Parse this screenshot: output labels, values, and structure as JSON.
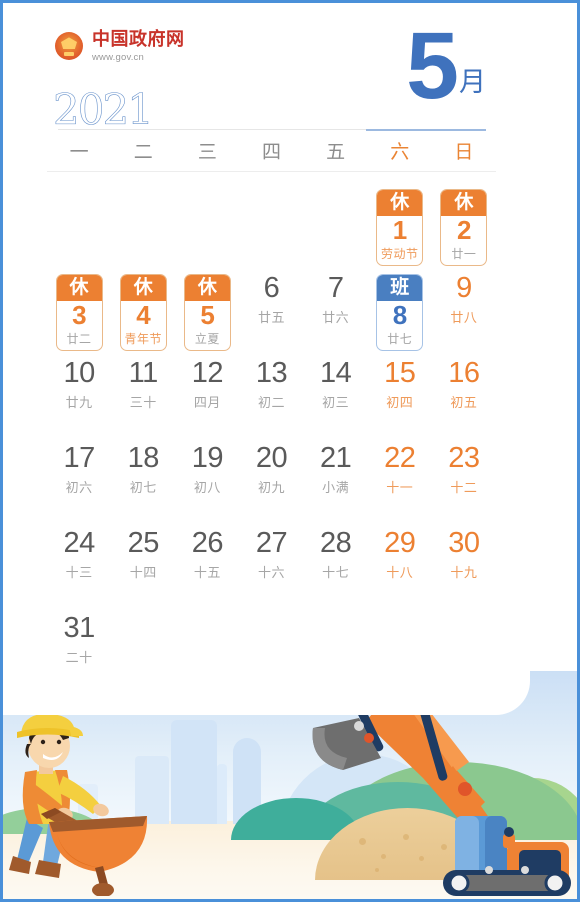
{
  "brand": {
    "logo_icon": "national-emblem-icon",
    "title": "中国政府网",
    "url": "www.gov.cn",
    "title_color": "#c8332a"
  },
  "header": {
    "year": "2021",
    "month_number": "5",
    "month_suffix": "月",
    "accent_blue": "#3f72bd",
    "accent_orange": "#ec8032"
  },
  "weekdays": [
    {
      "label": "一",
      "weekend": false
    },
    {
      "label": "二",
      "weekend": false
    },
    {
      "label": "三",
      "weekend": false
    },
    {
      "label": "四",
      "weekend": false
    },
    {
      "label": "五",
      "weekend": false
    },
    {
      "label": "六",
      "weekend": true
    },
    {
      "label": "日",
      "weekend": true
    }
  ],
  "badge_labels": {
    "rest": "休",
    "work": "班"
  },
  "weeks": [
    [
      {
        "day": "",
        "lunar": "",
        "empty": true
      },
      {
        "day": "",
        "lunar": "",
        "empty": true
      },
      {
        "day": "",
        "lunar": "",
        "empty": true
      },
      {
        "day": "",
        "lunar": "",
        "empty": true
      },
      {
        "day": "",
        "lunar": "",
        "empty": true
      },
      {
        "day": "1",
        "lunar": "劳动节",
        "badge": "rest",
        "festival": true,
        "weekend": true
      },
      {
        "day": "2",
        "lunar": "廿一",
        "badge": "rest",
        "weekend": true
      }
    ],
    [
      {
        "day": "3",
        "lunar": "廿二",
        "badge": "rest"
      },
      {
        "day": "4",
        "lunar": "青年节",
        "badge": "rest",
        "festival": true
      },
      {
        "day": "5",
        "lunar": "立夏",
        "badge": "rest"
      },
      {
        "day": "6",
        "lunar": "廿五"
      },
      {
        "day": "7",
        "lunar": "廿六"
      },
      {
        "day": "8",
        "lunar": "廿七",
        "badge": "work",
        "weekend": true
      },
      {
        "day": "9",
        "lunar": "廿八",
        "weekend": true
      }
    ],
    [
      {
        "day": "10",
        "lunar": "廿九"
      },
      {
        "day": "11",
        "lunar": "三十"
      },
      {
        "day": "12",
        "lunar": "四月"
      },
      {
        "day": "13",
        "lunar": "初二"
      },
      {
        "day": "14",
        "lunar": "初三"
      },
      {
        "day": "15",
        "lunar": "初四",
        "weekend": true
      },
      {
        "day": "16",
        "lunar": "初五",
        "weekend": true
      }
    ],
    [
      {
        "day": "17",
        "lunar": "初六"
      },
      {
        "day": "18",
        "lunar": "初七"
      },
      {
        "day": "19",
        "lunar": "初八"
      },
      {
        "day": "20",
        "lunar": "初九"
      },
      {
        "day": "21",
        "lunar": "小满"
      },
      {
        "day": "22",
        "lunar": "十一",
        "weekend": true
      },
      {
        "day": "23",
        "lunar": "十二",
        "weekend": true
      }
    ],
    [
      {
        "day": "24",
        "lunar": "十三"
      },
      {
        "day": "25",
        "lunar": "十四"
      },
      {
        "day": "26",
        "lunar": "十五"
      },
      {
        "day": "27",
        "lunar": "十六"
      },
      {
        "day": "28",
        "lunar": "十七"
      },
      {
        "day": "29",
        "lunar": "十八",
        "weekend": true
      },
      {
        "day": "30",
        "lunar": "十九",
        "weekend": true
      }
    ],
    [
      {
        "day": "31",
        "lunar": "二十"
      },
      {
        "day": "",
        "lunar": "",
        "empty": true
      },
      {
        "day": "",
        "lunar": "",
        "empty": true
      },
      {
        "day": "",
        "lunar": "",
        "empty": true
      },
      {
        "day": "",
        "lunar": "",
        "empty": true
      },
      {
        "day": "",
        "lunar": "",
        "empty": true,
        "weekend": true
      },
      {
        "day": "",
        "lunar": "",
        "empty": true,
        "weekend": true
      }
    ]
  ],
  "illustration": {
    "name": "construction-scene",
    "elements": [
      "worker-with-wheelbarrow",
      "excavator",
      "sand-pile",
      "green-hills",
      "city-skyline"
    ],
    "colors": {
      "helmet": "#f4cf3f",
      "vest": "#ee8b35",
      "jeans": "#5b9ad6",
      "excavator_body": "#ef8234",
      "bucket": "#6e6e6e",
      "sand": "#e9c88f",
      "hill_green": "#5fb99f",
      "sky": "#cfe2f6"
    }
  }
}
